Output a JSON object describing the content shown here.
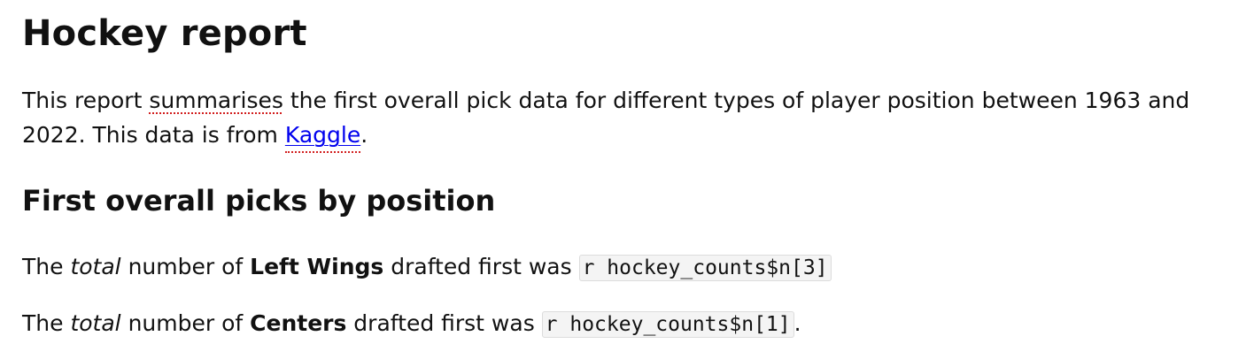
{
  "report": {
    "title": "Hockey report",
    "intro": {
      "before_spell": "This report ",
      "spell_word": "summarises",
      "after_spell": " the first overall pick data for different types of player position between 1963 and 2022. This data is from ",
      "link_text": "Kaggle",
      "end": "."
    },
    "section_title": "First overall picks by position",
    "left_wings_line": {
      "prefix": "The ",
      "emphasis": "total",
      "middle": " number of ",
      "strong": "Left Wings",
      "suffix": " drafted first was ",
      "code": "r hockey_counts$n[3]",
      "end": ""
    },
    "centers_line": {
      "prefix": "The ",
      "emphasis": "total",
      "middle": " number of ",
      "strong": "Centers",
      "suffix": " drafted first was ",
      "code": "r hockey_counts$n[1]",
      "end": "."
    }
  },
  "colors": {
    "link": "#0000ee",
    "spellcheck_underline": "#d21f1f",
    "code_background": "#f4f4f4"
  }
}
